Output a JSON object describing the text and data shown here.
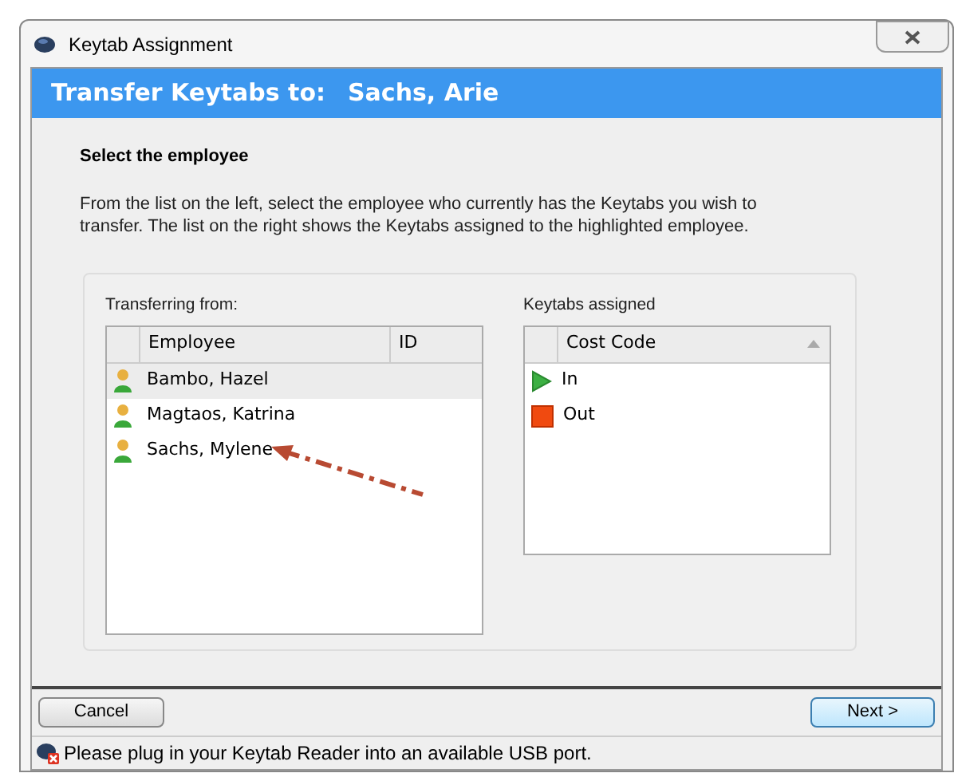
{
  "window": {
    "title": "Keytab Assignment"
  },
  "header": {
    "label": "Transfer Keytabs to:",
    "name": "Sachs, Arie"
  },
  "heading": "Select the employee",
  "instructions": "From the list on the left, select the employee who currently has the Keytabs you wish to transfer.  The list on the right shows the Keytabs assigned to the highlighted employee.",
  "left_list": {
    "label": "Transferring from:",
    "columns": [
      "Employee",
      "ID"
    ],
    "rows": [
      {
        "name": "Bambo, Hazel",
        "selected": true
      },
      {
        "name": "Magtaos, Katrina",
        "selected": false
      },
      {
        "name": "Sachs, Mylene",
        "selected": false
      }
    ]
  },
  "right_list": {
    "label": "Keytabs assigned",
    "columns": [
      "Cost Code"
    ],
    "rows": [
      {
        "kind": "in",
        "label": "In"
      },
      {
        "kind": "out",
        "label": "Out"
      }
    ]
  },
  "buttons": {
    "cancel": "Cancel",
    "next": "Next >"
  },
  "status_bar": {
    "message": "Please plug in your Keytab Reader into an available USB port."
  }
}
